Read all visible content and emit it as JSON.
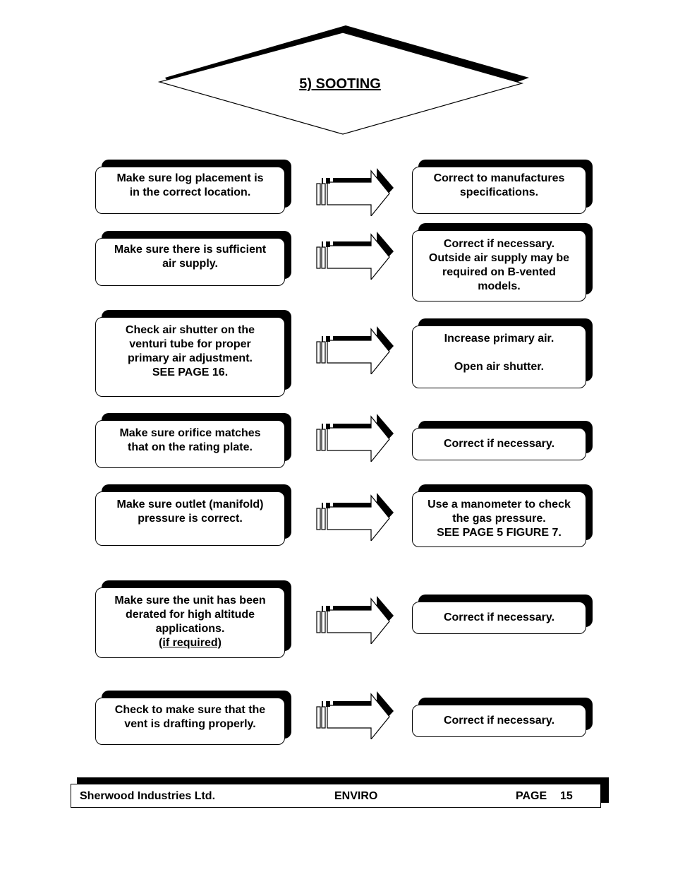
{
  "header": {
    "title": "5) SOOTING"
  },
  "rows": [
    {
      "check": "Make sure log placement is\nin the correct location.",
      "action": "Correct to manufactures\nspecifications."
    },
    {
      "check": "Make sure there is sufficient\nair supply.",
      "action": "Correct if necessary.\nOutside air supply may be\nrequired on B-vented\nmodels."
    },
    {
      "check": "Check air shutter on the\nventuri tube for proper\nprimary air adjustment.\nSEE PAGE 16.",
      "action": "Increase primary air.\n\nOpen air shutter."
    },
    {
      "check": "Make sure orifice matches\nthat on the rating plate.",
      "action": "Correct if necessary."
    },
    {
      "check": "Make sure outlet (manifold)\npressure is correct.",
      "action": "Use a manometer to check\nthe gas pressure.\nSEE PAGE 5 FIGURE 7."
    },
    {
      "check": "Make sure the unit has been\nderated for high altitude\napplications.",
      "check_note": "(if required)",
      "action": "Correct if necessary."
    },
    {
      "check": "Check to make sure that the\nvent is drafting properly.",
      "action": "Correct if necessary."
    }
  ],
  "footer": {
    "company": "Sherwood Industries Ltd.",
    "product": "ENVIRO",
    "page_label": "PAGE",
    "page_number": "15"
  },
  "icons": {
    "arrow": "right-arrow-icon"
  }
}
